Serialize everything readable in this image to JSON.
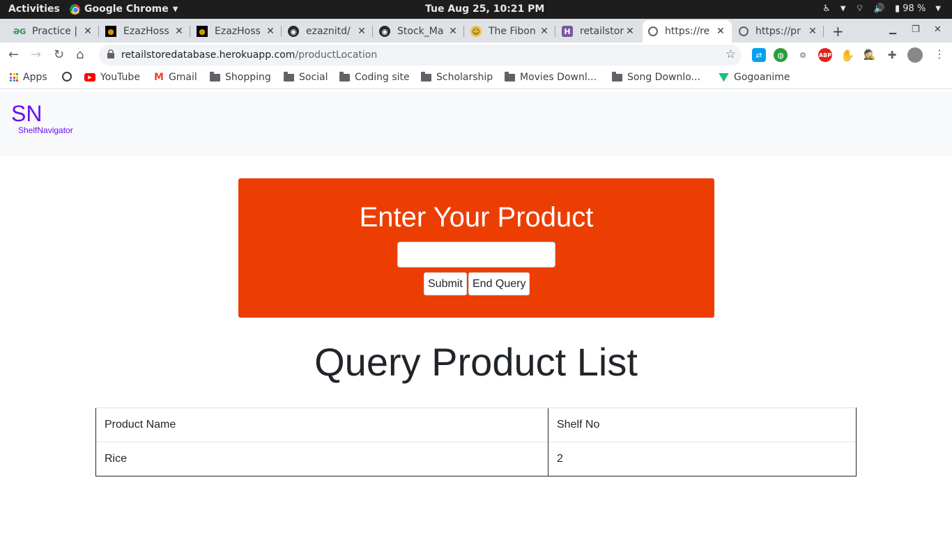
{
  "system": {
    "activities": "Activities",
    "app_name": "Google Chrome",
    "clock": "Tue Aug 25, 10:21 PM",
    "battery": "98 %"
  },
  "tabs": [
    {
      "title": "Practice |",
      "icon": "gfg-icon"
    },
    {
      "title": "EzazHoss",
      "icon": "site-icon"
    },
    {
      "title": "EzazHoss",
      "icon": "site-icon"
    },
    {
      "title": "ezaznitd/",
      "icon": "github-icon"
    },
    {
      "title": "Stock_Ma",
      "icon": "github-icon"
    },
    {
      "title": "The Fibon",
      "icon": "emoji-icon"
    },
    {
      "title": "retailstor",
      "icon": "heroku-icon"
    },
    {
      "title": "https://re",
      "icon": "globe-icon"
    },
    {
      "title": "https://pr",
      "icon": "globe-icon"
    }
  ],
  "address_bar": {
    "host": "retailstoredatabase.herokuapp.com",
    "path": "/productLocation"
  },
  "bookmarks": [
    {
      "label": "Apps"
    },
    {
      "label": ""
    },
    {
      "label": "YouTube"
    },
    {
      "label": "Gmail"
    },
    {
      "label": "Shopping"
    },
    {
      "label": "Social"
    },
    {
      "label": "Coding site"
    },
    {
      "label": "Scholarship"
    },
    {
      "label": "Movies Downl..."
    },
    {
      "label": "Song Downlo..."
    },
    {
      "label": "Gogoanime"
    }
  ],
  "page": {
    "brand": "SN",
    "brand_sub": "ShelfNavigator",
    "form_title": "Enter Your Product",
    "product_input_value": "",
    "submit_label": "Submit",
    "end_query_label": "End Query",
    "list_title": "Query Product List",
    "table": {
      "headers": [
        "Product Name",
        "Shelf No"
      ],
      "rows": [
        [
          "Rice",
          "2"
        ]
      ]
    }
  },
  "colors": {
    "brand": "#6610f2",
    "card": "#ec3e02"
  }
}
